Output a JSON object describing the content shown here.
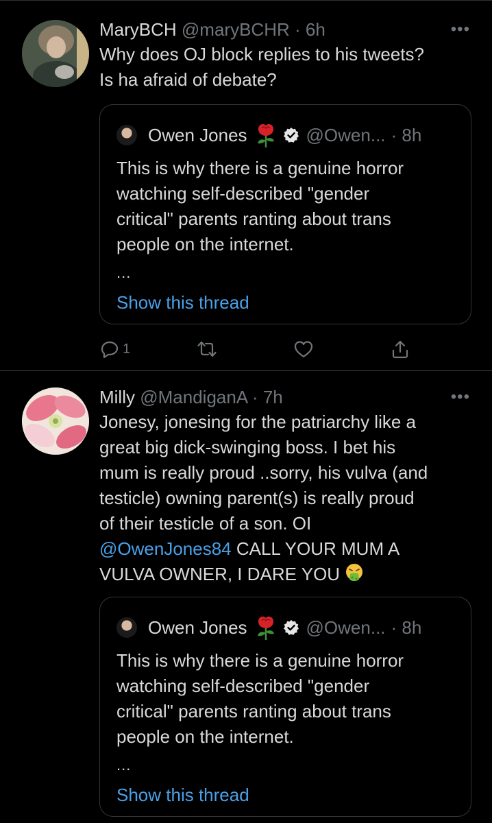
{
  "tweets": [
    {
      "name": "MaryBCH",
      "handle": "@maryBCHR",
      "time": "· 6h",
      "more": "•••",
      "lines": [
        "Why does OJ block replies to his tweets?",
        "Is ha afraid of debate?"
      ],
      "quote": {
        "name": "Owen Jones",
        "handle": "@Owen...",
        "time": "· 8h",
        "lines": [
          "This is why there is a genuine horror",
          "watching self-described \"gender",
          "critical\" parents ranting about trans",
          "people on the internet."
        ],
        "ellipsis": "...",
        "link": "Show this thread"
      },
      "actions": {
        "reply_count": "1"
      }
    },
    {
      "name": "Milly",
      "handle": "@MandiganA",
      "time": "· 7h",
      "more": "•••",
      "lines": [
        "Jonesy, jonesing for the patriarchy like a",
        "great big dick-swinging boss. I bet his",
        "mum is really proud ..sorry, his vulva (and",
        "testicle) owning parent(s) is really proud",
        "of their testicle of a son. OI"
      ],
      "mention": "@OwenJones84",
      "after_mention": " CALL YOUR MUM A",
      "last_line": "VULVA OWNER, I DARE YOU",
      "quote": {
        "name": "Owen Jones",
        "handle": "@Owen...",
        "time": "· 8h",
        "lines": [
          "This is why there is a genuine horror",
          "watching self-described \"gender",
          "critical\" parents ranting about trans",
          "people on the internet."
        ],
        "ellipsis": "...",
        "link": "Show this thread"
      }
    }
  ],
  "colors": {
    "background": "#000000",
    "text": "#d9d9d9",
    "muted": "#71767b",
    "link": "#4aa0e8",
    "border": "#2f3336"
  },
  "icons": [
    "more-icon",
    "rose-emoji-icon",
    "verified-badge-icon",
    "reply-icon",
    "retweet-icon",
    "like-icon",
    "share-icon",
    "vomit-emoji-icon"
  ]
}
